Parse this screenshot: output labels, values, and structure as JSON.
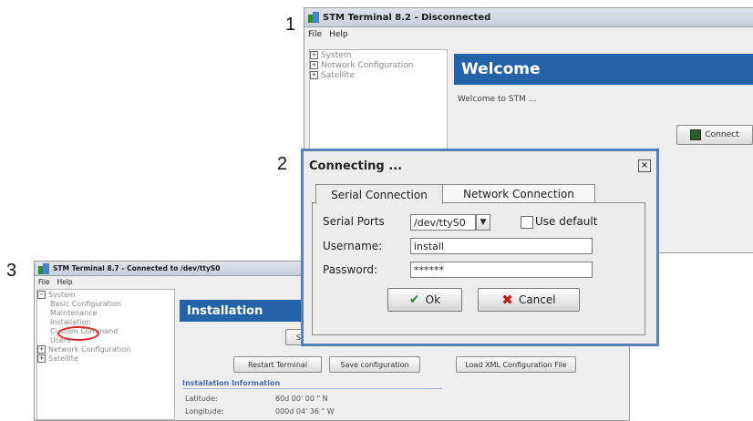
{
  "steps": {
    "one": "1",
    "two": "2",
    "three": "3"
  },
  "window1": {
    "title": "STM Terminal 8.2 - Disconnected",
    "menu": [
      "File",
      "Help"
    ],
    "tree": [
      "System",
      "Network Configuration",
      "Satellite"
    ],
    "banner": "Welcome",
    "text": "Welcome to STM ...",
    "connect_label": "Connect"
  },
  "dialog": {
    "title": "Connecting ...",
    "tabs": [
      "Serial Connection",
      "Network Connection"
    ],
    "serial_ports_label": "Serial Ports",
    "serial_port_value": "/dev/ttyS0",
    "use_default_label": "Use default",
    "username_label": "Username:",
    "username_value": "install",
    "password_label": "Password:",
    "password_value": "******",
    "ok_label": "Ok",
    "cancel_label": "Cancel"
  },
  "window3": {
    "title": "STM Terminal 8.7 - Connected to /dev/ttyS0",
    "menu": [
      "File",
      "Help"
    ],
    "tree": {
      "system": "System",
      "children": [
        "Basic Configuration",
        "Maintenance",
        "Installation",
        "Custom Command",
        "Users"
      ],
      "network": "Network Configuration",
      "satellite": "Satellite"
    },
    "banner": "Installation",
    "buttons": {
      "st": "St",
      "restart": "Restart Terminal",
      "save": "Save configuration",
      "load": "Load XML Configuration File"
    },
    "section": "Installation Information",
    "latitude_label": "Latitude:",
    "latitude_value": "60d 00' 00 \" N",
    "longitude_label": "Longitude:",
    "longitude_value": "000d 04' 36 \" W"
  }
}
